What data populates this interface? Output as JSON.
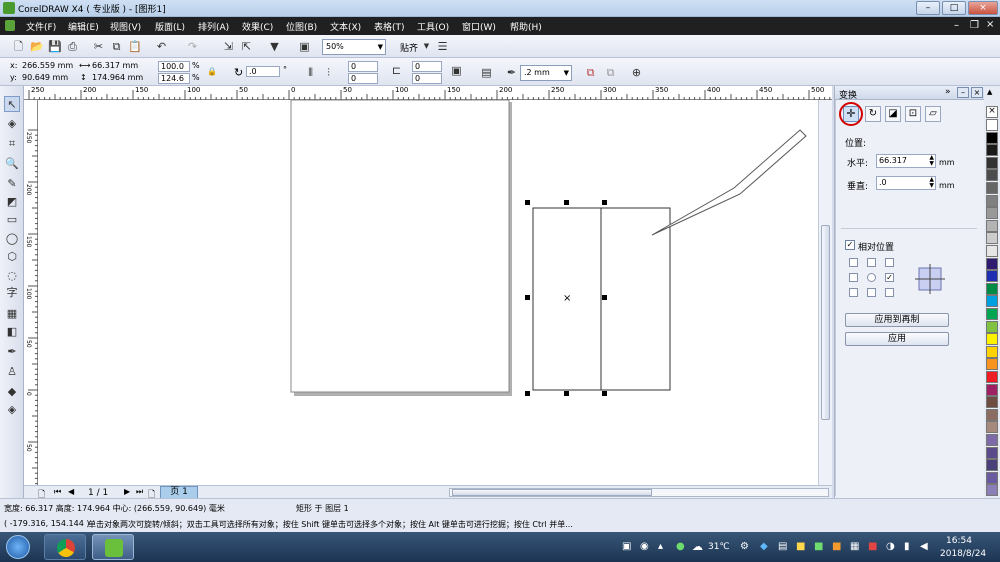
{
  "window": {
    "title": "CorelDRAW X4 ( 专业版 ) - [图形1]",
    "controls": [
      "–",
      "□",
      "×"
    ]
  },
  "menu": [
    "文件(F)",
    "编辑(E)",
    "视图(V)",
    "版面(L)",
    "排列(A)",
    "效果(C)",
    "位图(B)",
    "文本(X)",
    "表格(T)",
    "工具(O)",
    "窗口(W)",
    "帮助(H)"
  ],
  "toolbar": {
    "zoom": "50%",
    "snap_label": "贴齐"
  },
  "property_bar": {
    "x": "266.559 mm",
    "y": "90.649 mm",
    "width": "66.317 mm",
    "height": "174.964 mm",
    "scale_w": "100.0",
    "scale_h": "124.6",
    "percent": "%",
    "rotation": ".0",
    "degree": "°",
    "corner1": "0",
    "corner2": "0",
    "corner3": "0",
    "corner4": "0",
    "outline": ".2 mm"
  },
  "rulers": {
    "top_ticks": [
      "250",
      "200",
      "150",
      "100",
      "50",
      "0",
      "50",
      "100",
      "150",
      "200",
      "250",
      "300",
      "350",
      "400",
      "450",
      "500"
    ],
    "left_ticks": [
      "250",
      "200",
      "150",
      "100",
      "50",
      "0",
      "50"
    ]
  },
  "page_nav": {
    "counter": "1 / 1",
    "page_tab": "页 1"
  },
  "docker": {
    "title": "变换",
    "position_label": "位置:",
    "horizontal_label": "水平:",
    "horizontal_value": "66.317",
    "vertical_label": "垂直:",
    "vertical_value": ".0",
    "unit": "mm",
    "relative_label": "相对位置",
    "relative_checked": true,
    "apply_copy": "应用到再制",
    "apply": "应用"
  },
  "palette_colors": [
    "#ffffff",
    "#000000",
    "#1a1a1a",
    "#333333",
    "#4d4d4d",
    "#666666",
    "#808080",
    "#999999",
    "#b3b3b3",
    "#cccccc",
    "#e6e6e6",
    "#2e1a6e",
    "#1f2db0",
    "#008c45",
    "#00a0e0",
    "#00a651",
    "#7fc241",
    "#fff200",
    "#ffd200",
    "#f7941d",
    "#ee1d24",
    "#9e1f63",
    "#6d4c41",
    "#8c6d62",
    "#a58a7d",
    "#7c6aa6",
    "#5b4b8a",
    "#4a3f77",
    "#6a5aa0",
    "#8b7fb8"
  ],
  "status": {
    "dimensions": "宽度: 66.317  高度: 174.964  中心: (266.559, 90.649)  毫米",
    "object_info": "矩形 于 图层 1",
    "cursor": "( -179.316, 154.144 )",
    "hint": "单击对象两次可旋转/倾斜；双击工具可选择所有对象；按住 Shift 键单击可选择多个对象；按住 Alt 键单击可进行挖掘；按住 Ctrl 并单..."
  },
  "taskbar": {
    "temperature": "31℃",
    "time": "16:54",
    "date": "2018/8/24"
  }
}
